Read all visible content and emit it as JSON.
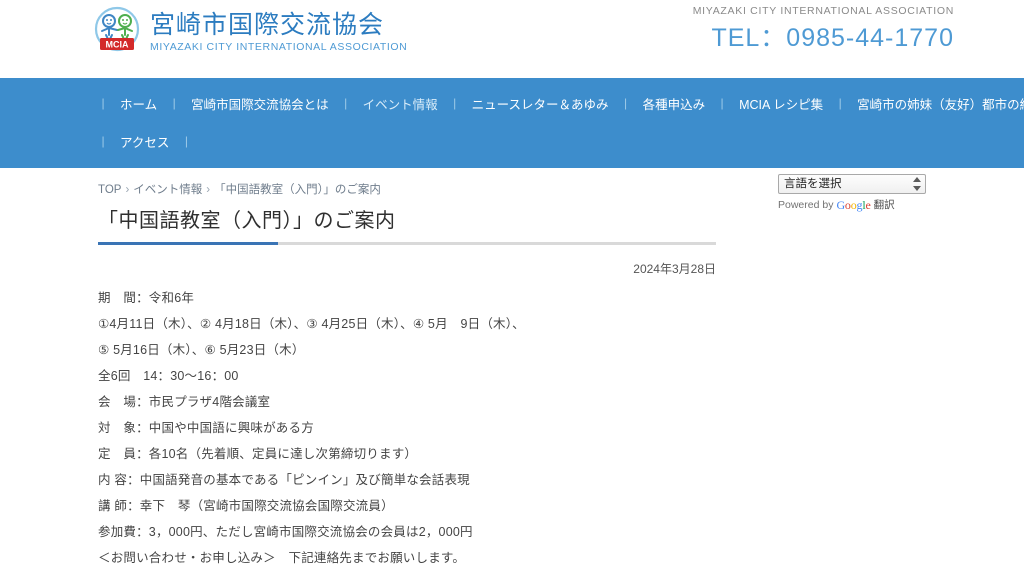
{
  "header": {
    "logo_jp": "宮崎市国際交流協会",
    "logo_en": "MIYAZAKI CITY INTERNATIONAL ASSOCIATION",
    "logo_badge": "MCIA",
    "assoc_en": "MIYAZAKI CITY INTERNATIONAL ASSOCIATION",
    "tel": "TEL：0985-44-1770"
  },
  "nav": {
    "separator": "|",
    "row1": [
      {
        "label": "ホーム",
        "active": false
      },
      {
        "label": "宮崎市国際交流協会とは",
        "active": false
      },
      {
        "label": "イベント情報",
        "active": true
      },
      {
        "label": "ニュースレター＆あゆみ",
        "active": false
      },
      {
        "label": "各種申込み",
        "active": false
      },
      {
        "label": "MCIA レシピ集",
        "active": false
      },
      {
        "label": "宮崎市の姉妹（友好）都市の紹介",
        "active": false
      }
    ],
    "row2": [
      {
        "label": "アクセス",
        "active": false
      }
    ]
  },
  "breadcrumb": {
    "top": "TOP",
    "arrow": "›",
    "section": "イベント情報",
    "current": "「中国語教室（入門）」のご案内"
  },
  "main": {
    "title": "「中国語教室（入門）」のご案内",
    "date": "2024年3月28日",
    "lines": [
      "期　間：令和6年",
      "①4月11日（木）、② 4月18日（木）、③ 4月25日（木）、④ 5月　9日（木）、",
      "⑤ 5月16日（木）、⑥ 5月23日（木）",
      "全6回　14：30〜16：00",
      "会　場：市民プラザ4階会議室",
      "対　象：中国や中国語に興味がある方",
      "定　員：各10名（先着順、定員に達し次第締切ります）",
      "内 容：中国語発音の基本である「ピンイン」及び簡単な会話表現",
      "講 師：幸下　琴（宮崎市国際交流協会国際交流員）",
      "参加費：3，000円、ただし宮崎市国際交流協会の会員は2，000円",
      "＜お問い合わせ・お申し込み＞　下記連絡先までお願いします。"
    ]
  },
  "translate": {
    "selected": "言語を選択",
    "powered_by": "Powered by",
    "google": [
      "G",
      "o",
      "o",
      "g",
      "l",
      "e"
    ],
    "translate_label": "翻訳"
  },
  "colors": {
    "nav_blue": "#3d8dcc",
    "logo_blue": "#2c7cc0",
    "tel_blue": "#4e9ad4",
    "title_rule_blue": "#3a74b5"
  }
}
